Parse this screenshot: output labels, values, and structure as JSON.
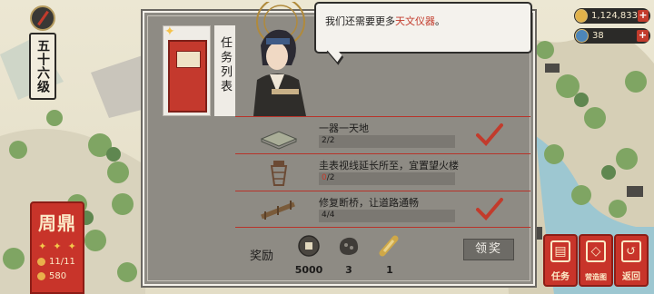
{
  "hud": {
    "level_label": "五十六级",
    "dynasty": {
      "name": "周鼎",
      "stars": [
        "✦",
        "✦",
        "✦"
      ],
      "progress": "11/11",
      "population": "580"
    },
    "resources": {
      "coins": "1,124,833",
      "books": "38",
      "plus": "+"
    }
  },
  "panel": {
    "list_title": "任务列表",
    "speech": {
      "prefix": "我们还需要更多",
      "highlight": "天文仪器",
      "suffix": "。"
    },
    "tasks": [
      {
        "title": "一器一天地",
        "current": "2",
        "total": "/2",
        "completed": true,
        "icon": "platform-icon"
      },
      {
        "title": "圭表视线延长所至，宜置望火楼",
        "current": "0",
        "total": "/2",
        "completed": false,
        "icon": "watchtower-icon"
      },
      {
        "title": "修复断桥，让道路通畅",
        "current": "4",
        "total": "/4",
        "completed": true,
        "icon": "bridge-icon"
      }
    ],
    "rewards": {
      "label": "奖励",
      "items": [
        {
          "icon": "coin-icon",
          "value": "5000"
        },
        {
          "icon": "stone-icon",
          "value": "3"
        },
        {
          "icon": "scroll-icon",
          "value": "1"
        }
      ],
      "claim_label": "领奖"
    }
  },
  "side_buttons": {
    "task": "任务",
    "book": "营造图",
    "back": "返回"
  },
  "colors": {
    "accent_red": "#c23b2c",
    "panel_gray": "#8e8b84",
    "paper": "#efece6"
  }
}
